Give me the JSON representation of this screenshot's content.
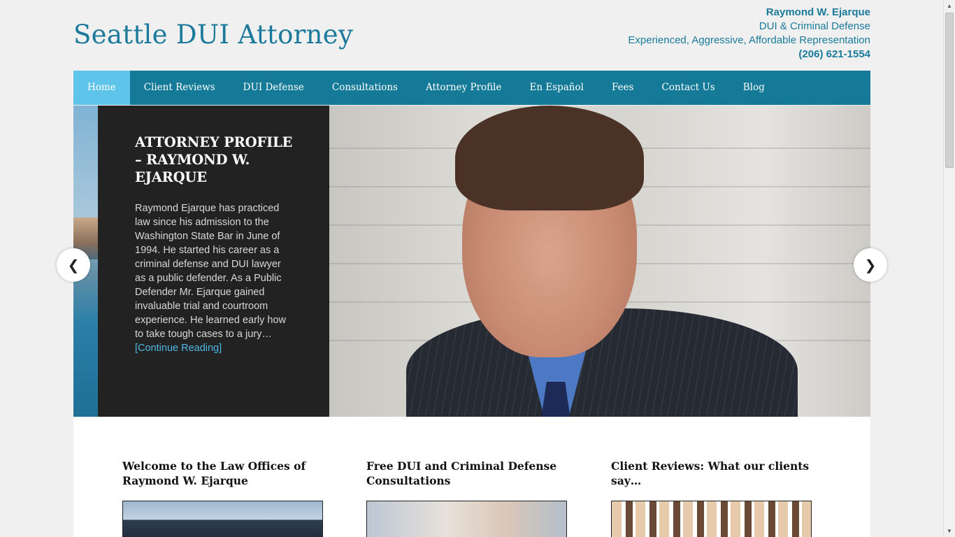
{
  "header": {
    "site_title": "Seattle DUI Attorney",
    "contact_name": "Raymond W. Ejarque",
    "contact_line1": "DUI & Criminal Defense",
    "contact_line2": "Experienced, Aggressive, Affordable Representation",
    "contact_phone": "(206) 621-1554"
  },
  "nav": {
    "items": [
      {
        "label": "Home",
        "active": true
      },
      {
        "label": "Client Reviews"
      },
      {
        "label": "DUI Defense"
      },
      {
        "label": "Consultations"
      },
      {
        "label": "Attorney Profile"
      },
      {
        "label": "En Español"
      },
      {
        "label": "Fees"
      },
      {
        "label": "Contact Us"
      },
      {
        "label": "Blog"
      }
    ]
  },
  "slider": {
    "title": "ATTORNEY PROFILE – RAYMOND W. EJARQUE",
    "body": "Raymond Ejarque has practiced law since his admission to the Washington State Bar in June of 1994. He started his career as a criminal defense and DUI lawyer as a public defender. As a Public Defender Mr. Ejarque gained invaluable trial and courtroom experience. He learned early how to take tough cases to a jury…",
    "more_link": "[Continue Reading]",
    "prev_icon": "chevron-left-icon",
    "next_icon": "chevron-right-icon"
  },
  "columns": [
    {
      "title": "Welcome to the Law Offices of Raymond W. Ejarque"
    },
    {
      "title": "Free DUI and Criminal Defense Consultations"
    },
    {
      "title": "Client Reviews: What our clients say…"
    }
  ],
  "colors": {
    "brand": "#1b7a9b",
    "nav_bg": "#147a97",
    "nav_active": "#5ec4ea",
    "caption_bg": "#222222",
    "link": "#4fb7e3"
  }
}
